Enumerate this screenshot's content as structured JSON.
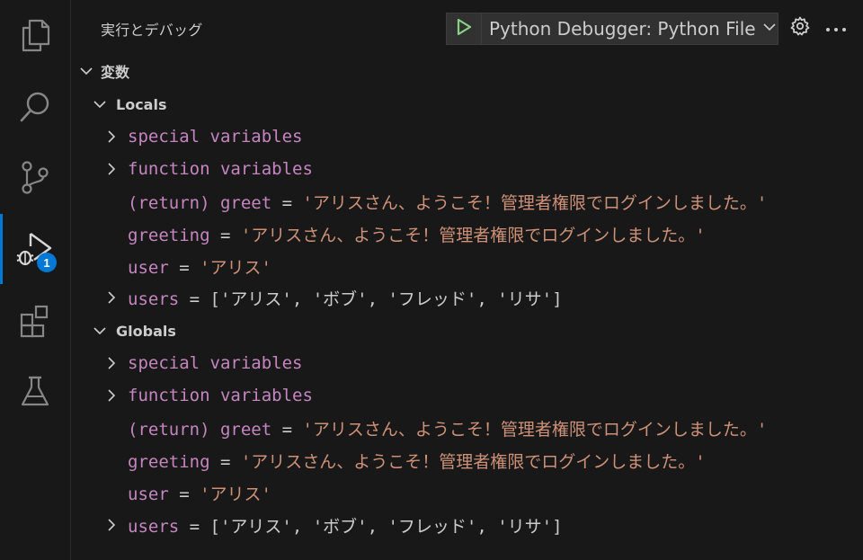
{
  "activity_bar": {
    "items": [
      {
        "name": "explorer",
        "icon": "files-icon"
      },
      {
        "name": "search",
        "icon": "search-icon"
      },
      {
        "name": "source-control",
        "icon": "source-control-icon"
      },
      {
        "name": "run-and-debug",
        "icon": "run-debug-icon",
        "badge": "1",
        "active": true
      },
      {
        "name": "extensions",
        "icon": "extensions-icon"
      },
      {
        "name": "testing",
        "icon": "flask-icon"
      }
    ]
  },
  "header": {
    "title": "実行とデバッグ",
    "config": "Python Debugger: Python File"
  },
  "variables": {
    "section_title": "変数",
    "scopes": [
      {
        "label": "Locals",
        "special": "special variables",
        "function": "function variables",
        "return_name": "(return) greet",
        "return_value": "'アリスさん、ようこそ！管理者権限でログインしました。'",
        "greeting_name": "greeting",
        "greeting_value": "'アリスさん、ようこそ！管理者権限でログインしました。'",
        "user_name": "user",
        "user_value": "'アリス'",
        "users_name": "users",
        "users_value": "['アリス', 'ボブ', 'フレッド', 'リサ']"
      },
      {
        "label": "Globals",
        "special": "special variables",
        "function": "function variables",
        "return_name": "(return) greet",
        "return_value": "'アリスさん、ようこそ！管理者権限でログインしました。'",
        "greeting_name": "greeting",
        "greeting_value": "'アリスさん、ようこそ！管理者権限でログインしました。'",
        "user_name": "user",
        "user_value": "'アリス'",
        "users_name": "users",
        "users_value": "['アリス', 'ボブ', 'フレッド', 'リサ']"
      }
    ],
    "equals": " = "
  },
  "colors": {
    "accent": "#0078d4",
    "var_name": "#c586c0",
    "string_value": "#ce9178",
    "start_green": "#89d185"
  }
}
